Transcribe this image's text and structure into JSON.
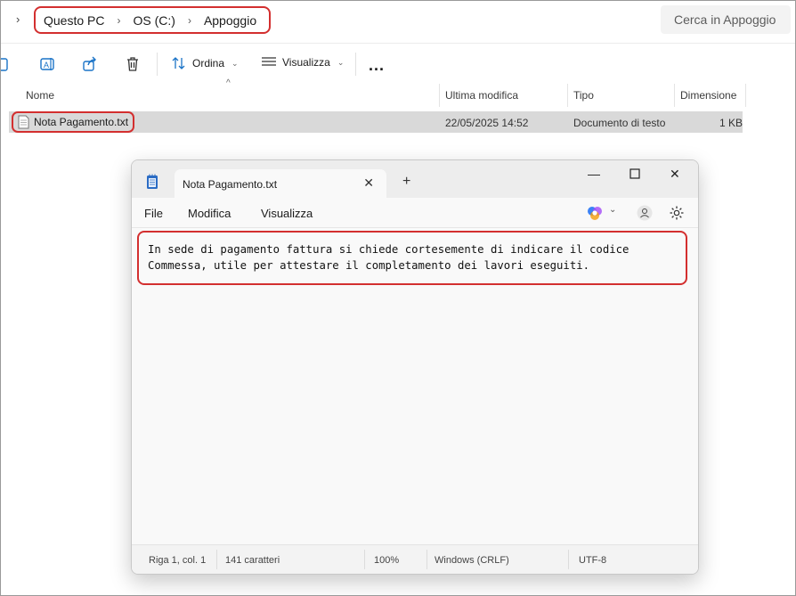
{
  "explorer": {
    "breadcrumb": [
      "Questo PC",
      "OS (C:)",
      "Appoggio"
    ],
    "search_placeholder": "Cerca in Appoggio",
    "toolbar": {
      "sort_label": "Ordina",
      "view_label": "Visualizza",
      "more_label": "..."
    },
    "columns": {
      "name": "Nome",
      "modified": "Ultima modifica",
      "type": "Tipo",
      "size": "Dimensione"
    },
    "file": {
      "name": "Nota Pagamento.txt",
      "modified": "22/05/2025 14:52",
      "type": "Documento di testo",
      "size": "1 KB"
    }
  },
  "notepad": {
    "tab_title": "Nota Pagamento.txt",
    "menu": {
      "file": "File",
      "edit": "Modifica",
      "view": "Visualizza"
    },
    "content_lines": [
      "In sede di pagamento fattura si chiede cortesemente di indicare il codice",
      "Commessa, utile per attestare il completamento dei lavori eseguiti."
    ],
    "status": {
      "position": "Riga 1, col. 1",
      "chars": "141 caratteri",
      "zoom": "100%",
      "line_ending": "Windows (CRLF)",
      "encoding": "UTF-8"
    }
  },
  "colors": {
    "highlight_border": "#d32f2f",
    "selected_row": "#d9d9d9"
  }
}
